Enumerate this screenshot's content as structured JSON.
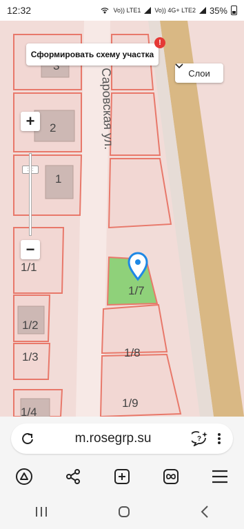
{
  "status_bar": {
    "time": "12:32",
    "network_1": "Vo)) LTE1",
    "network_2": "Vo)) 4G+ LTE2",
    "battery": "35%"
  },
  "map": {
    "scheme_button": "Сформировать схему участка",
    "alert_badge": "!",
    "layers_button": "Слои",
    "zoom_in": "+",
    "zoom_out": "−",
    "street_label": "Саровская ул.",
    "plots": [
      "3",
      "2",
      "1",
      "1/1",
      "1/2",
      "1/3",
      "1/4",
      "1/7",
      "1/8",
      "1/9"
    ],
    "selected_plot": "1/7",
    "colors": {
      "plot_fill": "#f2d7d3",
      "plot_border": "#e8786a",
      "selected_fill": "#8fd17a",
      "road": "#d8b380",
      "building": "#cdb8b4"
    }
  },
  "browser": {
    "url": "m.rosegrp.su"
  },
  "toolbar": {
    "icons": [
      "alice-icon",
      "share-icon",
      "new-tab-icon",
      "tabs-icon",
      "menu-icon"
    ]
  },
  "nav": {
    "icons": [
      "recents-icon",
      "home-icon",
      "back-icon"
    ]
  }
}
